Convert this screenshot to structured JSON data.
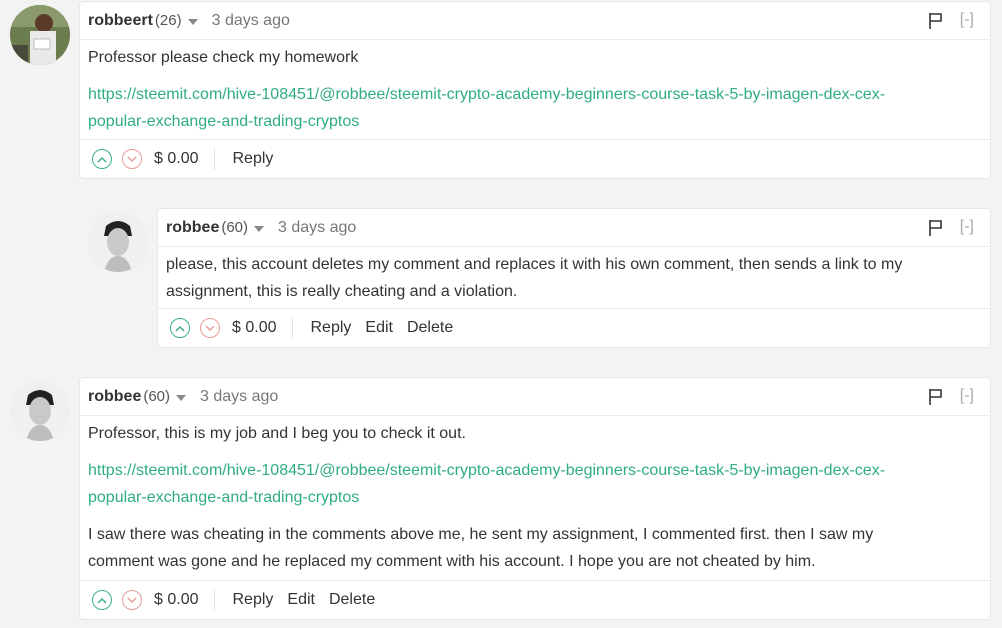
{
  "comments": [
    {
      "author": "robbeert",
      "rep": "(26)",
      "time": "3 days ago",
      "collapse": "[-]",
      "paragraphs": [
        "Professor please check my homework"
      ],
      "link1": "https://steemit.com/hive-108451/@robbee/steemit-crypto-academy-beginners-course-task-5-by-imagen-dex-cex-",
      "link2": "popular-exchange-and-trading-cryptos",
      "payout": "$ 0.00",
      "actions": [
        "Reply"
      ]
    },
    {
      "author": "robbee",
      "rep": "(60)",
      "time": "3 days ago",
      "collapse": "[-]",
      "line1": "please, this account deletes my comment and replaces it with his own comment, then sends a link to my",
      "line2": "assignment, this is really cheating and a violation.",
      "payout": "$ 0.00",
      "actions": [
        "Reply",
        "Edit",
        "Delete"
      ]
    },
    {
      "author": "robbee",
      "rep": "(60)",
      "time": "3 days ago",
      "collapse": "[-]",
      "intro": "Professor, this is my job and I beg you to check it out.",
      "link1": "https://steemit.com/hive-108451/@robbee/steemit-crypto-academy-beginners-course-task-5-by-imagen-dex-cex-",
      "link2": "popular-exchange-and-trading-cryptos",
      "line1": "I saw there was cheating in the comments above me, he sent my assignment, I commented first. then I saw my",
      "line2": "comment was gone and he replaced my comment with his account. I hope you are not cheated by him.",
      "payout": "$ 0.00",
      "actions": [
        "Reply",
        "Edit",
        "Delete"
      ]
    }
  ],
  "colors": {
    "link": "#2fac86",
    "upvote": "#3cb08f",
    "downvote": "#e99a9a"
  },
  "icons": {
    "flag": "flag-icon",
    "up": "chevron-up-icon",
    "down": "chevron-down-icon",
    "caret": "caret-down-icon"
  }
}
